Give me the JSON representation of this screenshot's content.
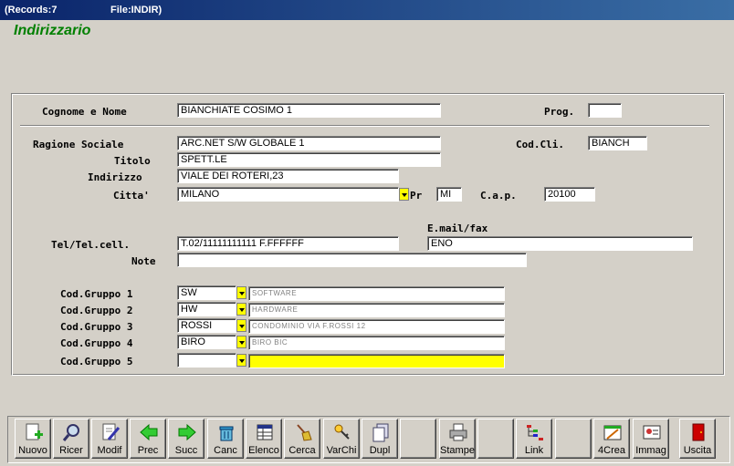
{
  "window": {
    "records": "(Records:7",
    "file": "File:INDIR)"
  },
  "app_title": "Indirizzario",
  "labels": {
    "cognome": "Cognome e Nome",
    "prog": "Prog.",
    "ragione": "Ragione Sociale",
    "codcli": "Cod.Cli.",
    "titolo": "Titolo",
    "indirizzo": "Indirizzo",
    "citta": "Citta'",
    "pr": "Pr",
    "cap": "C.a.p.",
    "email": "E.mail/fax",
    "tel": "Tel/Tel.cell.",
    "note": "Note",
    "g1": "Cod.Gruppo 1",
    "g2": "Cod.Gruppo 2",
    "g3": "Cod.Gruppo 3",
    "g4": "Cod.Gruppo 4",
    "g5": "Cod.Gruppo 5"
  },
  "fields": {
    "cognome": "BIANCHIATE COSIMO  1",
    "prog": "",
    "ragione": "ARC.NET S/W GLOBALE  1",
    "codcli": "BIANCH",
    "titolo": "SPETT.LE",
    "indirizzo": "VIALE DEI ROTERI,23",
    "citta": "MILANO",
    "pr": "MI",
    "cap": "20100",
    "tel": "T.02/11111111111 F.FFFFFF",
    "email": "ENO",
    "note": "",
    "g1": "SW",
    "g1d": "SOFTWARE",
    "g2": "HW",
    "g2d": "HARDWARE",
    "g3": "ROSSI",
    "g3d": "CONDOMINIO VIA F.ROSSI 12",
    "g4": "BIRO",
    "g4d": "BIRO BIC",
    "g5": "",
    "g5d": ""
  },
  "toolbar": {
    "nuovo": "Nuovo",
    "ricer": "Ricer",
    "modif": "Modif",
    "prec": "Prec",
    "succ": "Succ",
    "canc": "Canc",
    "elenco": "Elenco",
    "cerca": "Cerca",
    "varchi": "VarChi",
    "dupl": "Dupl",
    "stampe": "Stampe",
    "link": "Link",
    "crea": "4Crea",
    "immag": "Immag",
    "uscita": "Uscita"
  },
  "colors": {
    "app_title": "#008000",
    "titlebar": "#0a246a",
    "highlight_field": "#ffff00"
  }
}
